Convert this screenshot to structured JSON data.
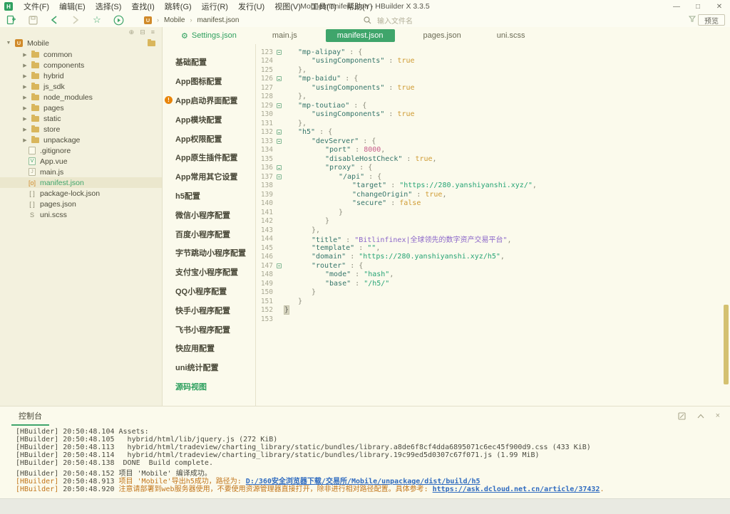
{
  "window": {
    "title": "Mobile/manifest.json - HBuilder X 3.3.5"
  },
  "menu": {
    "items": [
      "文件(F)",
      "编辑(E)",
      "选择(S)",
      "查找(I)",
      "跳转(G)",
      "运行(R)",
      "发行(U)",
      "视图(V)",
      "工具(T)",
      "帮助(Y)"
    ]
  },
  "toolbar": {
    "breadcrumb": [
      "Mobile",
      "manifest.json"
    ],
    "search_placeholder": "输入文件名",
    "preview_label": "预览"
  },
  "colors": {
    "accent_green": "#3FA56B",
    "warn_orange": "#C2751A",
    "error_badge": "#E8850C",
    "folder_tan": "#D9B65C"
  },
  "sidebar": {
    "root": "Mobile",
    "folders": [
      "common",
      "components",
      "hybrid",
      "js_sdk",
      "node_modules",
      "pages",
      "static",
      "store",
      "unpackage"
    ],
    "files": [
      {
        "name": ".gitignore",
        "icon": "file"
      },
      {
        "name": "App.vue",
        "icon": "vue"
      },
      {
        "name": "main.js",
        "icon": "js"
      },
      {
        "name": "manifest.json",
        "icon": "json-active",
        "selected": true
      },
      {
        "name": "package-lock.json",
        "icon": "json"
      },
      {
        "name": "pages.json",
        "icon": "json"
      },
      {
        "name": "uni.scss",
        "icon": "scss"
      }
    ]
  },
  "tabs": [
    {
      "label": "Settings.json",
      "icon": "gear",
      "active": false
    },
    {
      "label": "main.js",
      "active": false
    },
    {
      "label": "manifest.json",
      "active": true
    },
    {
      "label": "pages.json",
      "active": false
    },
    {
      "label": "uni.scss",
      "active": false
    }
  ],
  "settings_nav": {
    "items": [
      {
        "label": "基础配置"
      },
      {
        "label": "App图标配置"
      },
      {
        "label": "App启动界面配置",
        "error": true
      },
      {
        "label": "App模块配置"
      },
      {
        "label": "App权限配置"
      },
      {
        "label": "App原生插件配置"
      },
      {
        "label": "App常用其它设置"
      },
      {
        "label": "h5配置"
      },
      {
        "label": "微信小程序配置"
      },
      {
        "label": "百度小程序配置"
      },
      {
        "label": "字节跳动小程序配置"
      },
      {
        "label": "支付宝小程序配置"
      },
      {
        "label": "QQ小程序配置"
      },
      {
        "label": "快手小程序配置"
      },
      {
        "label": "飞书小程序配置"
      },
      {
        "label": "快应用配置"
      },
      {
        "label": "uni统计配置"
      },
      {
        "label": "源码视图",
        "active": true
      }
    ]
  },
  "editor": {
    "lines": [
      {
        "n": 123,
        "fold": true,
        "indent": 1,
        "seg": [
          [
            "key",
            "\"mp-alipay\""
          ],
          [
            "pun",
            " : {"
          ]
        ]
      },
      {
        "n": 124,
        "indent": 2,
        "seg": [
          [
            "key",
            "\"usingComponents\""
          ],
          [
            "pun",
            " : "
          ],
          [
            "bool",
            "true"
          ]
        ]
      },
      {
        "n": 125,
        "indent": 1,
        "seg": [
          [
            "pun",
            "},"
          ]
        ]
      },
      {
        "n": 126,
        "fold": true,
        "indent": 1,
        "seg": [
          [
            "key",
            "\"mp-baidu\""
          ],
          [
            "pun",
            " : {"
          ]
        ]
      },
      {
        "n": 127,
        "indent": 2,
        "seg": [
          [
            "key",
            "\"usingComponents\""
          ],
          [
            "pun",
            " : "
          ],
          [
            "bool",
            "true"
          ]
        ]
      },
      {
        "n": 128,
        "indent": 1,
        "seg": [
          [
            "pun",
            "},"
          ]
        ]
      },
      {
        "n": 129,
        "fold": true,
        "indent": 1,
        "seg": [
          [
            "key",
            "\"mp-toutiao\""
          ],
          [
            "pun",
            " : {"
          ]
        ]
      },
      {
        "n": 130,
        "indent": 2,
        "seg": [
          [
            "key",
            "\"usingComponents\""
          ],
          [
            "pun",
            " : "
          ],
          [
            "bool",
            "true"
          ]
        ]
      },
      {
        "n": 131,
        "indent": 1,
        "seg": [
          [
            "pun",
            "},"
          ]
        ]
      },
      {
        "n": 132,
        "fold": true,
        "indent": 1,
        "seg": [
          [
            "key",
            "\"h5\""
          ],
          [
            "pun",
            " : {"
          ]
        ]
      },
      {
        "n": 133,
        "fold": true,
        "indent": 2,
        "seg": [
          [
            "key",
            "\"devServer\""
          ],
          [
            "pun",
            " : {"
          ]
        ]
      },
      {
        "n": 134,
        "indent": 3,
        "seg": [
          [
            "key",
            "\"port\""
          ],
          [
            "pun",
            " : "
          ],
          [
            "num",
            "8000"
          ],
          [
            "pun",
            ","
          ]
        ]
      },
      {
        "n": 135,
        "indent": 3,
        "seg": [
          [
            "key",
            "\"disableHostCheck\""
          ],
          [
            "pun",
            " : "
          ],
          [
            "bool",
            "true"
          ],
          [
            "pun",
            ","
          ]
        ]
      },
      {
        "n": 136,
        "fold": true,
        "indent": 3,
        "seg": [
          [
            "key",
            "\"proxy\""
          ],
          [
            "pun",
            " : {"
          ]
        ]
      },
      {
        "n": 137,
        "fold": true,
        "indent": 4,
        "seg": [
          [
            "key",
            "\"/api\""
          ],
          [
            "pun",
            " : {"
          ]
        ]
      },
      {
        "n": 138,
        "indent": 5,
        "seg": [
          [
            "key",
            "\"target\""
          ],
          [
            "pun",
            " : "
          ],
          [
            "str",
            "\"https://280.yanshiyanshi.xyz/\""
          ],
          [
            "pun",
            ","
          ]
        ]
      },
      {
        "n": 139,
        "indent": 5,
        "seg": [
          [
            "key",
            "\"changeOrigin\""
          ],
          [
            "pun",
            " : "
          ],
          [
            "bool",
            "true"
          ],
          [
            "pun",
            ","
          ]
        ]
      },
      {
        "n": 140,
        "indent": 5,
        "seg": [
          [
            "key",
            "\"secure\""
          ],
          [
            "pun",
            " : "
          ],
          [
            "bool",
            "false"
          ]
        ]
      },
      {
        "n": 141,
        "indent": 4,
        "seg": [
          [
            "pun",
            "}"
          ]
        ]
      },
      {
        "n": 142,
        "indent": 3,
        "seg": [
          [
            "pun",
            "}"
          ]
        ]
      },
      {
        "n": 143,
        "indent": 2,
        "seg": [
          [
            "pun",
            "},"
          ]
        ]
      },
      {
        "n": 144,
        "indent": 2,
        "seg": [
          [
            "key",
            "\"title\""
          ],
          [
            "pun",
            " : "
          ],
          [
            "pur",
            "\"Bitlinfinex|全球领先的数字资产交易平台\""
          ],
          [
            "pun",
            ","
          ]
        ]
      },
      {
        "n": 145,
        "indent": 2,
        "seg": [
          [
            "key",
            "\"template\""
          ],
          [
            "pun",
            " : "
          ],
          [
            "str",
            "\"\""
          ],
          [
            "pun",
            ","
          ]
        ]
      },
      {
        "n": 146,
        "indent": 2,
        "seg": [
          [
            "key",
            "\"domain\""
          ],
          [
            "pun",
            " : "
          ],
          [
            "str",
            "\"https://280.yanshiyanshi.xyz/h5\""
          ],
          [
            "pun",
            ","
          ]
        ]
      },
      {
        "n": 147,
        "fold": true,
        "indent": 2,
        "seg": [
          [
            "key",
            "\"router\""
          ],
          [
            "pun",
            " : {"
          ]
        ]
      },
      {
        "n": 148,
        "indent": 3,
        "seg": [
          [
            "key",
            "\"mode\""
          ],
          [
            "pun",
            " : "
          ],
          [
            "str",
            "\"hash\""
          ],
          [
            "pun",
            ","
          ]
        ]
      },
      {
        "n": 149,
        "indent": 3,
        "seg": [
          [
            "key",
            "\"base\""
          ],
          [
            "pun",
            " : "
          ],
          [
            "str",
            "\"/h5/\""
          ]
        ]
      },
      {
        "n": 150,
        "indent": 2,
        "seg": [
          [
            "pun",
            "}"
          ]
        ]
      },
      {
        "n": 151,
        "indent": 1,
        "seg": [
          [
            "pun",
            "}"
          ]
        ]
      },
      {
        "n": 152,
        "indent": 0,
        "seg": [
          [
            "cur",
            "}"
          ]
        ]
      },
      {
        "n": 153,
        "indent": 0,
        "seg": []
      }
    ]
  },
  "console": {
    "tab_label": "控制台",
    "lines": [
      {
        "warn": false,
        "time": "20:50:48.104",
        "parts": [
          [
            "msg",
            "Assets:"
          ]
        ]
      },
      {
        "warn": false,
        "time": "20:50:48.105",
        "parts": [
          [
            "msg",
            "  hybrid/html/lib/jquery.js (272 KiB)"
          ]
        ]
      },
      {
        "warn": false,
        "time": "20:50:48.113",
        "parts": [
          [
            "msg",
            "  hybrid/html/tradeview/charting_library/static/bundles/library.a8de6f8cf4dda6895071c6ec45f900d9.css (433 KiB)"
          ]
        ]
      },
      {
        "warn": false,
        "time": "20:50:48.114",
        "parts": [
          [
            "msg",
            "  hybrid/html/tradeview/charting_library/static/bundles/library.19c99ed5d0307c67f071.js (1.99 MiB)"
          ]
        ]
      },
      {
        "warn": false,
        "time": "20:50:48.138",
        "parts": [
          [
            "msg",
            " DONE  Build complete."
          ]
        ]
      },
      {
        "warn": false,
        "time": "20:50:48.152",
        "parts": [
          [
            "msg",
            "项目 'Mobile' 编译成功。"
          ]
        ]
      },
      {
        "warn": true,
        "time": "20:50:48.913",
        "parts": [
          [
            "warn",
            "项目 'Mobile'导出h5成功，路径为: "
          ],
          [
            "link",
            "D:/360安全浏览器下载/交易所/Mobile/unpackage/dist/build/h5"
          ]
        ]
      },
      {
        "warn": true,
        "time": "20:50:48.920",
        "parts": [
          [
            "warn",
            "注意请部署到web服务器使用，不要使用资源管理器直接打开，除非进行相对路径配置。具体参考: "
          ],
          [
            "link",
            "https://ask.dcloud.net.cn/article/37432"
          ],
          [
            "warn",
            "."
          ]
        ]
      }
    ]
  }
}
